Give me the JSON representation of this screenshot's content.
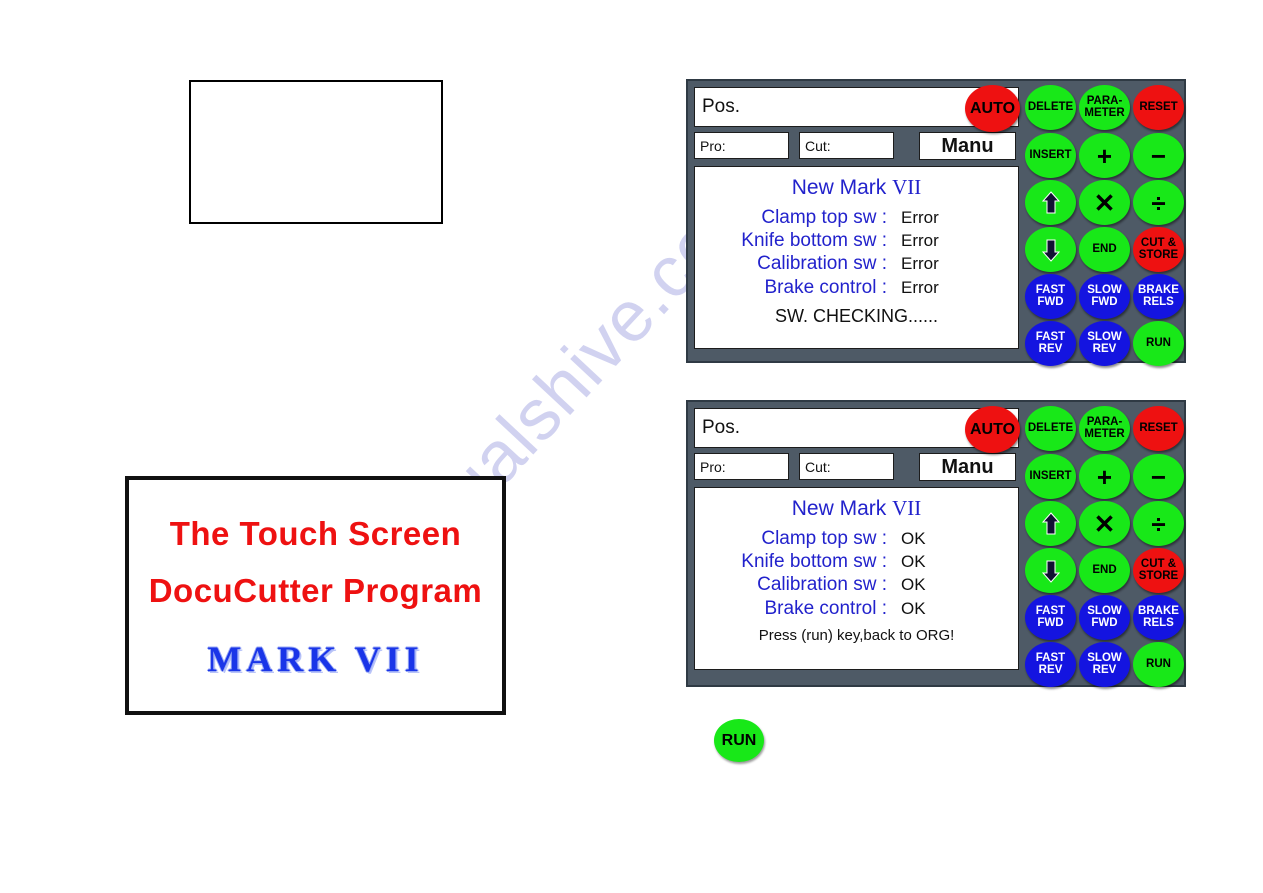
{
  "watermark": {
    "text": "manualshive.com"
  },
  "splash": {
    "line1": "The Touch Screen",
    "line2": "DocuCutter Program",
    "line3": "MARK VII",
    "red": "#ee1111",
    "blue": "#1a35e8"
  },
  "empty_box": {
    "content": ""
  },
  "panels": [
    {
      "id": "panel-error",
      "pos_label": "Pos.",
      "pro_label": "Pro:",
      "cut_label": "Cut:",
      "mode_button": "Manu",
      "display": {
        "title_prefix": "New Mark ",
        "title_numeral": "VII",
        "rows": [
          {
            "label": "Clamp top sw :",
            "value": "Error"
          },
          {
            "label": "Knife bottom sw :",
            "value": "Error"
          },
          {
            "label": "Calibration sw :",
            "value": "Error"
          },
          {
            "label": "Brake control :",
            "value": "Error"
          }
        ],
        "footer": "SW. CHECKING......"
      }
    },
    {
      "id": "panel-ok",
      "pos_label": "Pos.",
      "pro_label": "Pro:",
      "cut_label": "Cut:",
      "mode_button": "Manu",
      "display": {
        "title_prefix": "New Mark ",
        "title_numeral": "VII",
        "rows": [
          {
            "label": "Clamp top sw :",
            "value": "OK"
          },
          {
            "label": "Knife bottom sw :",
            "value": "OK"
          },
          {
            "label": "Calibration sw :",
            "value": "OK"
          },
          {
            "label": "Brake control :",
            "value": "OK"
          }
        ],
        "footer": "Press (run) key,back to ORG!"
      }
    }
  ],
  "keypad": {
    "auto": {
      "label": "AUTO",
      "color": "red"
    },
    "keys": [
      {
        "name": "delete",
        "lines": [
          "DELETE"
        ],
        "color": "green",
        "col": 0,
        "row": 0
      },
      {
        "name": "parameter",
        "lines": [
          "PARA-",
          "METER"
        ],
        "color": "green",
        "col": 1,
        "row": 0
      },
      {
        "name": "reset",
        "lines": [
          "RESET"
        ],
        "color": "red",
        "col": 2,
        "row": 0
      },
      {
        "name": "insert",
        "lines": [
          "INSERT"
        ],
        "color": "green",
        "col": 0,
        "row": 1
      },
      {
        "name": "plus",
        "lines": [
          "+"
        ],
        "color": "green",
        "col": 1,
        "row": 1,
        "big": true
      },
      {
        "name": "minus",
        "lines": [
          "−"
        ],
        "color": "green",
        "col": 2,
        "row": 1,
        "big": true
      },
      {
        "name": "arrow-up",
        "lines": [
          ""
        ],
        "color": "green",
        "col": 0,
        "row": 2,
        "icon": "arrow-up-icon"
      },
      {
        "name": "multiply",
        "lines": [
          "✕"
        ],
        "color": "green",
        "col": 1,
        "row": 2,
        "big": true
      },
      {
        "name": "divide",
        "lines": [
          "÷"
        ],
        "color": "green",
        "col": 2,
        "row": 2,
        "big": true
      },
      {
        "name": "arrow-down",
        "lines": [
          ""
        ],
        "color": "green",
        "col": 0,
        "row": 3,
        "icon": "arrow-down-icon"
      },
      {
        "name": "end",
        "lines": [
          "END"
        ],
        "color": "green",
        "col": 1,
        "row": 3
      },
      {
        "name": "cut-store",
        "lines": [
          "CUT &",
          "STORE"
        ],
        "color": "red",
        "col": 2,
        "row": 3
      },
      {
        "name": "fast-fwd",
        "lines": [
          "FAST",
          "FWD"
        ],
        "color": "blue",
        "col": 0,
        "row": 4
      },
      {
        "name": "slow-fwd",
        "lines": [
          "SLOW",
          "FWD"
        ],
        "color": "blue",
        "col": 1,
        "row": 4
      },
      {
        "name": "brake-rels",
        "lines": [
          "BRAKE",
          "RELS"
        ],
        "color": "blue",
        "col": 2,
        "row": 4
      },
      {
        "name": "fast-rev",
        "lines": [
          "FAST",
          "REV"
        ],
        "color": "blue",
        "col": 0,
        "row": 5
      },
      {
        "name": "slow-rev",
        "lines": [
          "SLOW",
          "REV"
        ],
        "color": "blue",
        "col": 1,
        "row": 5
      },
      {
        "name": "run",
        "lines": [
          "RUN"
        ],
        "color": "green",
        "col": 2,
        "row": 5
      }
    ]
  },
  "standalone_run": {
    "label": "RUN",
    "color": "#18e818"
  },
  "colors": {
    "panel_background": "#4e5a66",
    "key_green": "#18e818",
    "key_red": "#ee1111",
    "key_blue": "#1414e0",
    "display_blue_text": "#2222cc"
  }
}
